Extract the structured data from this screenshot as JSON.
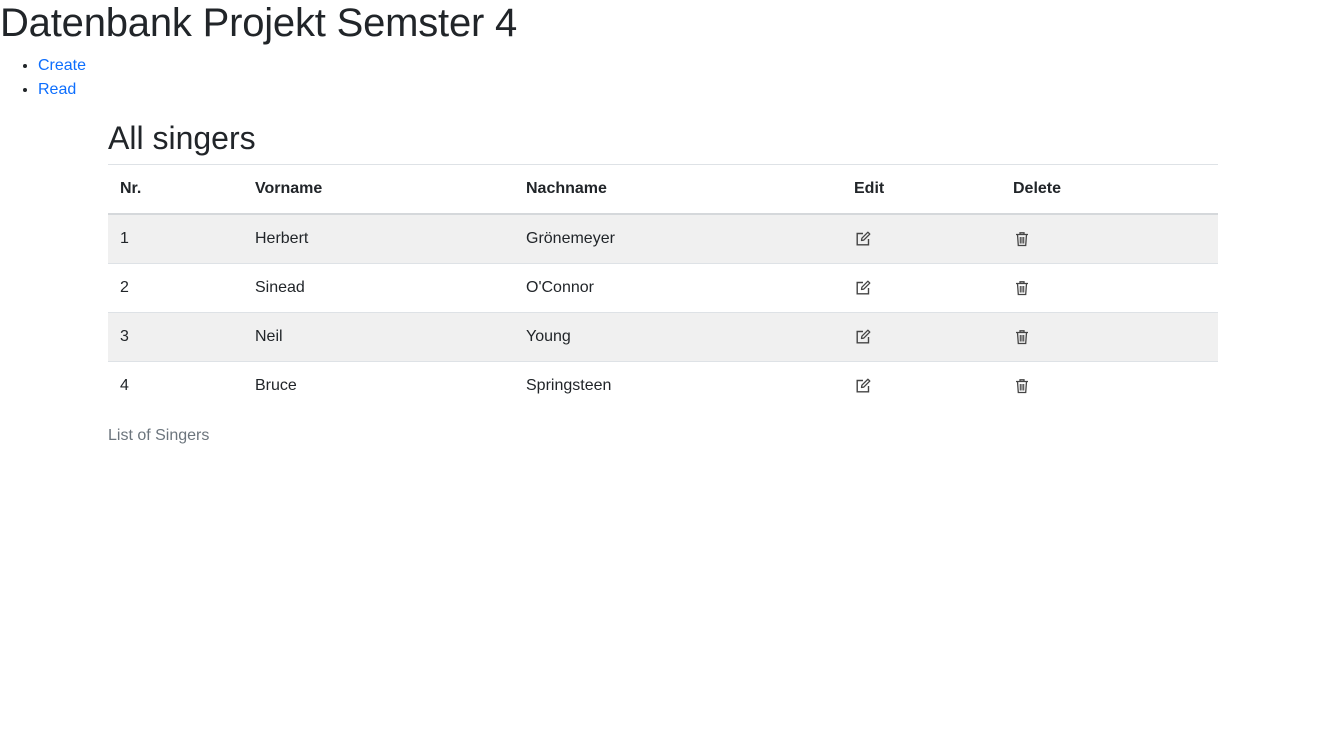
{
  "page": {
    "title": "Datenbank Projekt Semster 4"
  },
  "nav": {
    "items": [
      {
        "label": "Create"
      },
      {
        "label": "Read"
      }
    ]
  },
  "main": {
    "heading": "All singers",
    "table": {
      "headers": {
        "nr": "Nr.",
        "vorname": "Vorname",
        "nachname": "Nachname",
        "edit": "Edit",
        "delete": "Delete"
      },
      "rows": [
        {
          "nr": "1",
          "vorname": "Herbert",
          "nachname": "Grönemeyer",
          "edit_icon": "edit-icon",
          "delete_icon": "trash-icon"
        },
        {
          "nr": "2",
          "vorname": "Sinead",
          "nachname": "O'Connor",
          "edit_icon": "edit-icon",
          "delete_icon": "trash-icon"
        },
        {
          "nr": "3",
          "vorname": "Neil",
          "nachname": "Young",
          "edit_icon": "edit-icon",
          "delete_icon": "trash-icon"
        },
        {
          "nr": "4",
          "vorname": "Bruce",
          "nachname": "Springsteen",
          "edit_icon": "edit-icon",
          "delete_icon": "trash-icon"
        }
      ]
    },
    "caption": "List of Singers"
  },
  "colors": {
    "link": "#0d6efd",
    "stripe": "#f0f0f0",
    "text": "#212529",
    "muted": "#6c757d"
  }
}
